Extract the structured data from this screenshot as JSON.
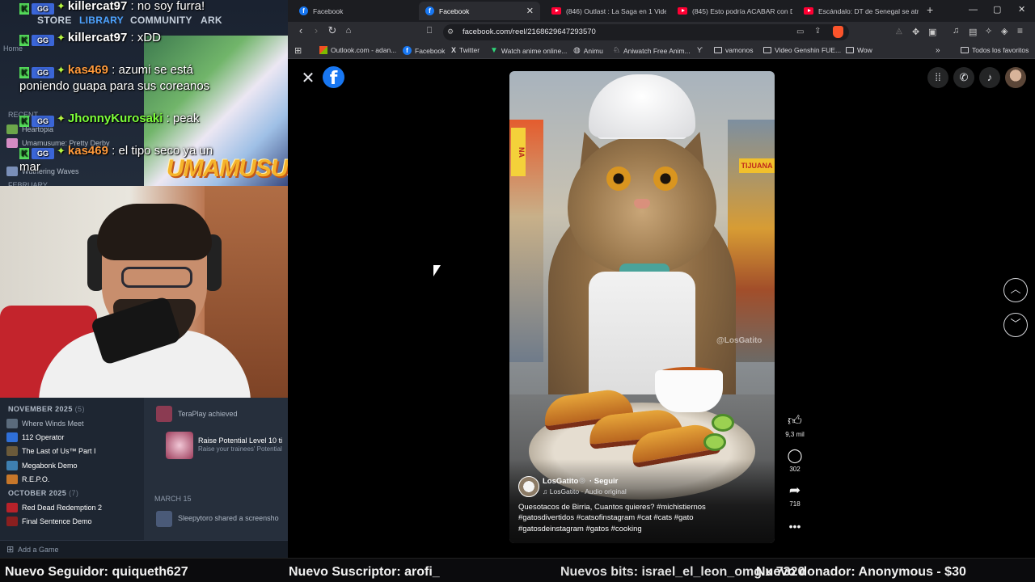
{
  "steam": {
    "nav": [
      "STORE",
      "LIBRARY",
      "COMMUNITY",
      "ARK"
    ],
    "home": "Home",
    "recent_label": "RECENT",
    "recent_items": [
      "Heartopia",
      "Umamusume: Pretty Derby",
      "Wuthering Waves"
    ],
    "feb_label": "FEBRUARY",
    "nov_section": {
      "label": "NOVEMBER 2025",
      "count": "(5)"
    },
    "nov_games": [
      "Where Winds Meet",
      "112 Operator",
      "The Last of Us™ Part I",
      "Megabonk Demo",
      "R.E.P.O."
    ],
    "oct_section": {
      "label": "OCTOBER 2025",
      "count": "(7)"
    },
    "oct_games": [
      "Red Dead Redemption 2",
      "Final Sentence Demo"
    ],
    "add_game": "Add a Game",
    "art_logo": "UMAMUSUME",
    "activity": {
      "achiever": "TeraPlay",
      "achieved": "achieved",
      "ach_title": "Raise Potential Level 10 ti",
      "ach_desc": "Raise your trainees' Potential",
      "date": "MARCH 15",
      "screenshot_user": "Sleepytoro",
      "screenshot_text": "shared a screensho"
    }
  },
  "chat": [
    {
      "user": "killercat97",
      "user_color": "#ffffff",
      "msg": "no soy furra!"
    },
    {
      "user": "killercat97",
      "user_color": "#ffffff",
      "msg": "xDD"
    },
    {
      "user": "kas469",
      "user_color": "#ff9a3c",
      "msg": "azumi se está poniendo guapa para sus coreanos"
    },
    {
      "user": "JhonnyKurosaki",
      "user_color": "#7dff3a",
      "msg": "peak"
    },
    {
      "user": "kas469",
      "user_color": "#ff9a3c",
      "msg": "el tipo seco ya un mar"
    }
  ],
  "browser": {
    "tabs": [
      {
        "title": "Facebook",
        "type": "fb",
        "active": false
      },
      {
        "title": "Facebook",
        "type": "fb",
        "active": true
      },
      {
        "title": "(846) Outlast : La Saga en 1 Video",
        "type": "yt",
        "active": false
      },
      {
        "title": "(845) Esto podría ACABAR con Du",
        "type": "yt",
        "active": false
      },
      {
        "title": "Escándalo: DT de Senegal se atrinc",
        "type": "yt",
        "active": false
      }
    ],
    "new_tab": "+",
    "url": "facebook.com/reel/2168629647293570",
    "bookmarks": [
      "Outlook.com - adan...",
      "Facebook",
      "Twitter",
      "Watch anime online...",
      "Animu",
      "Aniwatch Free Anim...",
      "vamonos",
      "Video Genshin FUE...",
      "Wow"
    ],
    "all_bookmarks": "Todos los favoritos",
    "window_controls": [
      "—",
      "▢",
      "✕"
    ]
  },
  "reel": {
    "author": "LosGatito",
    "verified": "◎",
    "follow": "· Seguir",
    "audio": "♫ LosGatito · Audio original",
    "caption": "Quesotacos de Birria, Cuantos quieres?  #michistiernos #gatosdivertidos #catsofinstagram #cat #cats #gato #gatosdeinstagram #gatos #cooking",
    "watermark": "@LosGatito",
    "likes": "9,3 mil",
    "comments": "302",
    "shares": "718",
    "sign_left": "NA",
    "sign_right": "TIJUANA"
  },
  "stream": {
    "follower": "Nuevo Seguidor: quiqueth627",
    "subscriber": "Nuevo Suscriptor: arofi_",
    "bits": "Nuevos bits: israel_el_leon_omg x 7320",
    "donor": "Nuevo donador: Anonymous - $30"
  },
  "colors": {
    "fb_blue": "#1877f2",
    "steam_bg": "#1b2431",
    "yt_red": "#ff0033"
  }
}
